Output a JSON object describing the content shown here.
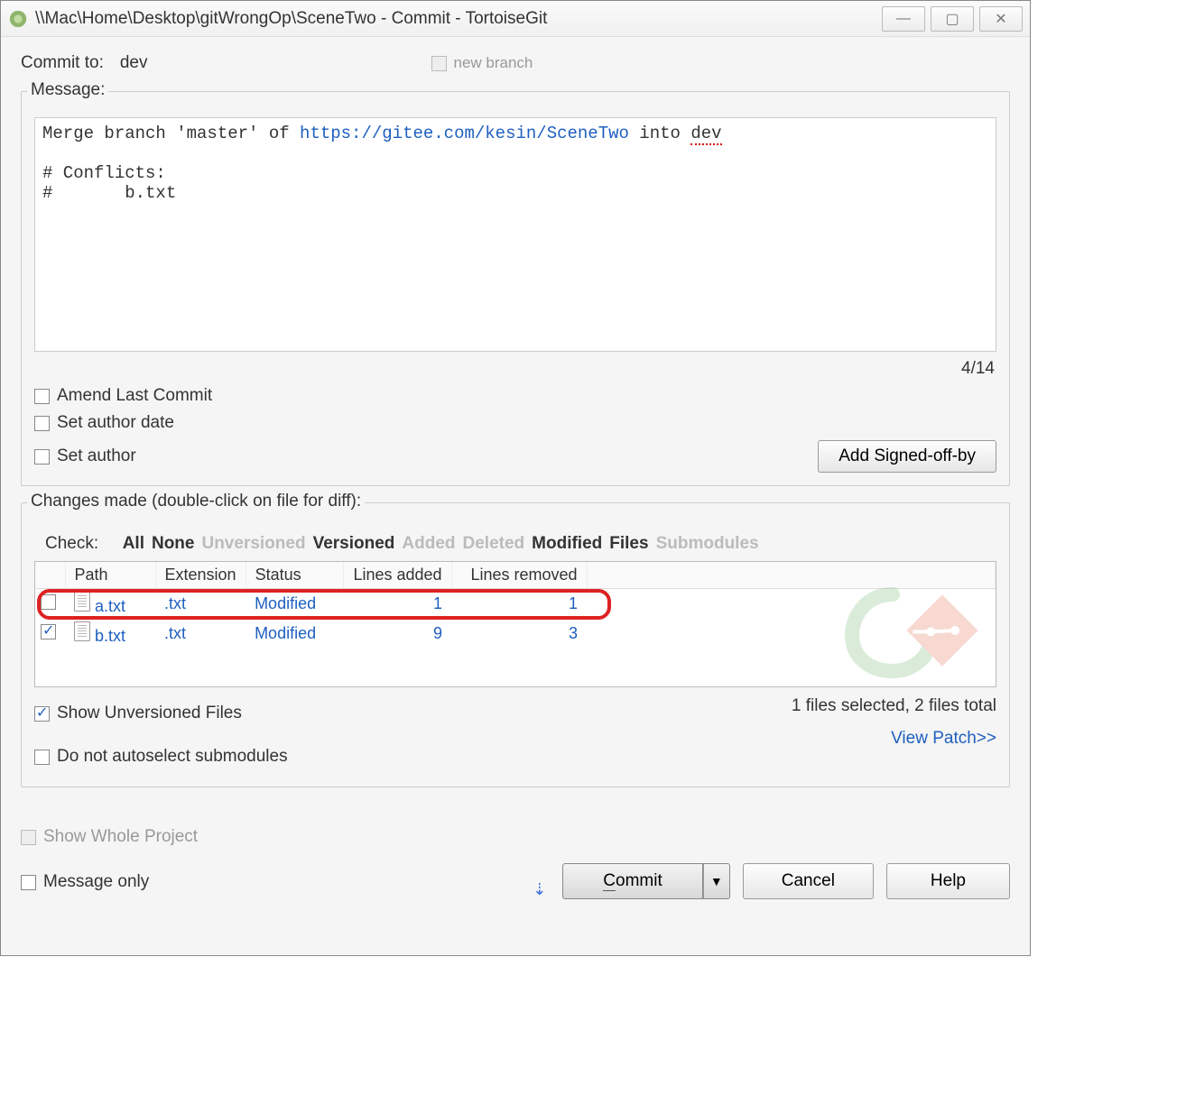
{
  "window": {
    "title": "\\\\Mac\\Home\\Desktop\\gitWrongOp\\SceneTwo - Commit - TortoiseGit"
  },
  "header": {
    "commit_to_label": "Commit to:",
    "branch_name": "dev",
    "new_branch_label": "new branch"
  },
  "message_group": {
    "label": "Message:",
    "line1_prefix": "Merge branch 'master' of ",
    "url": "https://gitee.com/kesin/SceneTwo",
    "line1_mid": " into ",
    "line1_tail": "dev",
    "line3": "# Conflicts:",
    "line4": "#       b.txt",
    "line_col": "4/14",
    "amend_label": "Amend Last Commit",
    "set_author_date_label": "Set author date",
    "set_author_label": "Set author",
    "signed_off_button": "Add Signed-off-by"
  },
  "changes_group": {
    "label": "Changes made (double-click on file for diff):",
    "check_label": "Check:",
    "filters": {
      "all": "All",
      "none": "None",
      "unversioned": "Unversioned",
      "versioned": "Versioned",
      "added": "Added",
      "deleted": "Deleted",
      "modified": "Modified",
      "files": "Files",
      "submodules": "Submodules"
    },
    "columns": {
      "path": "Path",
      "extension": "Extension",
      "status": "Status",
      "lines_added": "Lines added",
      "lines_removed": "Lines removed"
    },
    "rows": [
      {
        "checked": false,
        "path": "a.txt",
        "ext": ".txt",
        "status": "Modified",
        "added": "1",
        "removed": "1"
      },
      {
        "checked": true,
        "path": "b.txt",
        "ext": ".txt",
        "status": "Modified",
        "added": "9",
        "removed": "3"
      }
    ],
    "show_unversioned_label": "Show Unversioned Files",
    "no_autoselect_label": "Do not autoselect submodules",
    "files_status": "1 files selected, 2 files total",
    "view_patch": "View Patch>>"
  },
  "bottom": {
    "show_whole_project": "Show Whole Project",
    "message_only": "Message only",
    "commit_button": "Commit",
    "cancel_button": "Cancel",
    "help_button": "Help"
  }
}
